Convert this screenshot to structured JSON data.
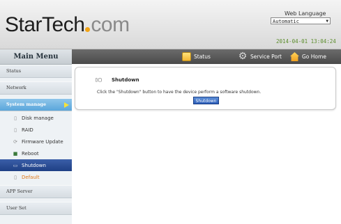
{
  "header": {
    "logo_dark": "StarTech",
    "logo_light": "com",
    "web_language_label": "Web Language",
    "language_value": "Automatic",
    "datetime": "2014-04-01 13:04:24"
  },
  "navbar": {
    "items": [
      {
        "label": "Status",
        "icon": "status-icon"
      },
      {
        "label": "Service Port",
        "icon": "gear-icon"
      },
      {
        "label": "Go Home",
        "icon": "home-icon"
      }
    ]
  },
  "sidebar": {
    "title": "Main Menu",
    "status": "Status",
    "network": "Network",
    "system_manage": "System manage",
    "sub_items": [
      {
        "label": "Disk manage",
        "icon": "disk-icon"
      },
      {
        "label": "RAID",
        "icon": "raid-icon"
      },
      {
        "label": "Firmware Update",
        "icon": "update-icon"
      },
      {
        "label": "Reboot",
        "icon": "reboot-icon"
      },
      {
        "label": "Shutdown",
        "icon": "shutdown-icon"
      },
      {
        "label": "Default",
        "icon": "default-icon"
      }
    ],
    "app_server": "APP Server",
    "user_set": "User Set"
  },
  "content": {
    "title": "Shutdown",
    "description": "Click the \"Shutdown\" button to have the device perform a software shutdown.",
    "button": "Shutdown"
  },
  "colors": {
    "accent_blue": "#5aa6db",
    "selected_blue": "#1e3f85",
    "datetime_green": "#5a8c2a",
    "logo_orange": "#f2a417"
  }
}
